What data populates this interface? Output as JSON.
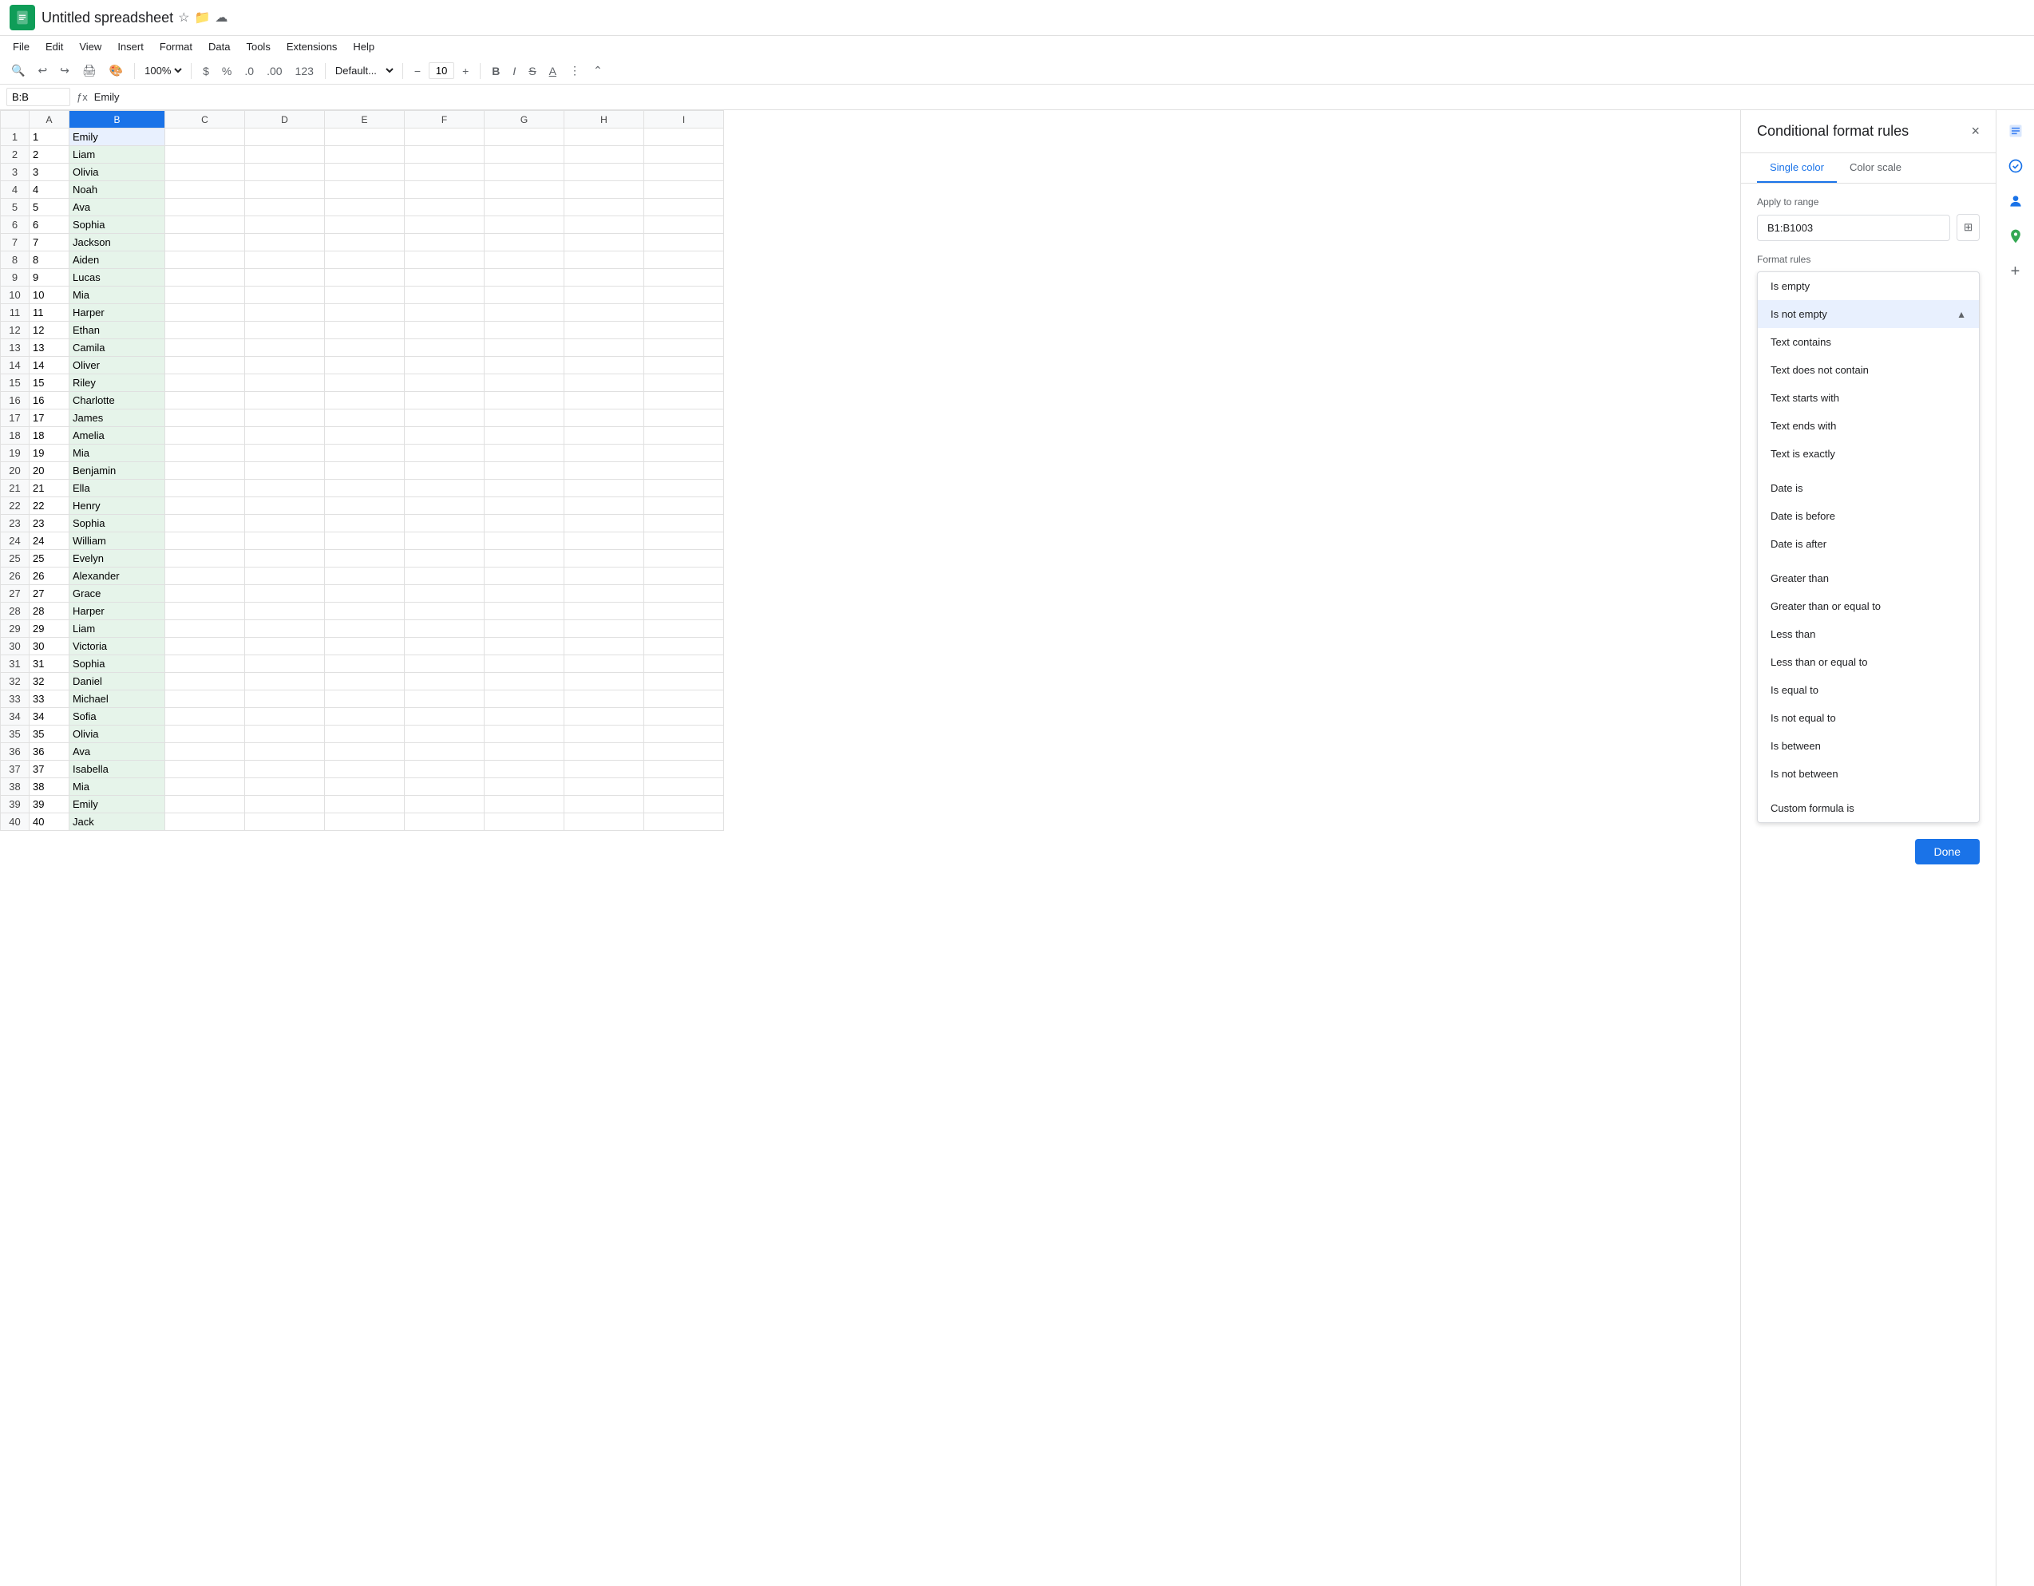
{
  "app": {
    "title": "Untitled spreadsheet",
    "icon_color": "#0f9d58"
  },
  "menu": {
    "items": [
      "File",
      "Edit",
      "View",
      "Insert",
      "Format",
      "Data",
      "Tools",
      "Extensions",
      "Help"
    ]
  },
  "toolbar": {
    "zoom": "100%",
    "font": "Default...",
    "font_size": "10",
    "bold": "B",
    "italic": "I",
    "strikethrough": "S"
  },
  "formula_bar": {
    "cell_ref": "B:B",
    "formula_text": "Emily"
  },
  "columns": [
    "",
    "A",
    "B",
    "C",
    "D",
    "E",
    "F",
    "G",
    "H",
    "I"
  ],
  "rows": [
    {
      "num": 1,
      "a": "1",
      "b": "Emily"
    },
    {
      "num": 2,
      "a": "2",
      "b": "Liam"
    },
    {
      "num": 3,
      "a": "3",
      "b": "Olivia"
    },
    {
      "num": 4,
      "a": "4",
      "b": "Noah"
    },
    {
      "num": 5,
      "a": "5",
      "b": "Ava"
    },
    {
      "num": 6,
      "a": "6",
      "b": "Sophia"
    },
    {
      "num": 7,
      "a": "7",
      "b": "Jackson"
    },
    {
      "num": 8,
      "a": "8",
      "b": "Aiden"
    },
    {
      "num": 9,
      "a": "9",
      "b": "Lucas"
    },
    {
      "num": 10,
      "a": "10",
      "b": "Mia"
    },
    {
      "num": 11,
      "a": "11",
      "b": "Harper"
    },
    {
      "num": 12,
      "a": "12",
      "b": "Ethan"
    },
    {
      "num": 13,
      "a": "13",
      "b": "Camila"
    },
    {
      "num": 14,
      "a": "14",
      "b": "Oliver"
    },
    {
      "num": 15,
      "a": "15",
      "b": "Riley"
    },
    {
      "num": 16,
      "a": "16",
      "b": "Charlotte"
    },
    {
      "num": 17,
      "a": "17",
      "b": "James"
    },
    {
      "num": 18,
      "a": "18",
      "b": "Amelia"
    },
    {
      "num": 19,
      "a": "19",
      "b": "Mia"
    },
    {
      "num": 20,
      "a": "20",
      "b": "Benjamin"
    },
    {
      "num": 21,
      "a": "21",
      "b": "Ella"
    },
    {
      "num": 22,
      "a": "22",
      "b": "Henry"
    },
    {
      "num": 23,
      "a": "23",
      "b": "Sophia"
    },
    {
      "num": 24,
      "a": "24",
      "b": "William"
    },
    {
      "num": 25,
      "a": "25",
      "b": "Evelyn"
    },
    {
      "num": 26,
      "a": "26",
      "b": "Alexander"
    },
    {
      "num": 27,
      "a": "27",
      "b": "Grace"
    },
    {
      "num": 28,
      "a": "28",
      "b": "Harper"
    },
    {
      "num": 29,
      "a": "29",
      "b": "Liam"
    },
    {
      "num": 30,
      "a": "30",
      "b": "Victoria"
    },
    {
      "num": 31,
      "a": "31",
      "b": "Sophia"
    },
    {
      "num": 32,
      "a": "32",
      "b": "Daniel"
    },
    {
      "num": 33,
      "a": "33",
      "b": "Michael"
    },
    {
      "num": 34,
      "a": "34",
      "b": "Sofia"
    },
    {
      "num": 35,
      "a": "35",
      "b": "Olivia"
    },
    {
      "num": 36,
      "a": "36",
      "b": "Ava"
    },
    {
      "num": 37,
      "a": "37",
      "b": "Isabella"
    },
    {
      "num": 38,
      "a": "38",
      "b": "Mia"
    },
    {
      "num": 39,
      "a": "39",
      "b": "Emily"
    },
    {
      "num": 40,
      "a": "40",
      "b": "Jack"
    }
  ],
  "panel": {
    "title": "Conditional format rules",
    "close_label": "×",
    "tab_single": "Single color",
    "tab_scale": "Color scale",
    "apply_label": "Apply to range",
    "range_value": "B1:B1003",
    "format_rules_label": "Format rules",
    "dropdown_items": [
      {
        "label": "Is empty",
        "selected": false
      },
      {
        "label": "Is not empty",
        "selected": true
      },
      {
        "label": "Text contains",
        "selected": false
      },
      {
        "label": "Text does not contain",
        "selected": false
      },
      {
        "label": "Text starts with",
        "selected": false
      },
      {
        "label": "Text ends with",
        "selected": false
      },
      {
        "label": "Text is exactly",
        "selected": false
      },
      {
        "spacer": true
      },
      {
        "label": "Date is",
        "selected": false
      },
      {
        "label": "Date is before",
        "selected": false
      },
      {
        "label": "Date is after",
        "selected": false
      },
      {
        "spacer": true
      },
      {
        "label": "Greater than",
        "selected": false
      },
      {
        "label": "Greater than or equal to",
        "selected": false
      },
      {
        "label": "Less than",
        "selected": false
      },
      {
        "label": "Less than or equal to",
        "selected": false
      },
      {
        "label": "Is equal to",
        "selected": false
      },
      {
        "label": "Is not equal to",
        "selected": false
      },
      {
        "label": "Is between",
        "selected": false
      },
      {
        "label": "Is not between",
        "selected": false
      },
      {
        "spacer": true
      },
      {
        "label": "Custom formula is",
        "selected": false
      }
    ],
    "done_label": "Done"
  },
  "side_icons": [
    "sheets-icon",
    "tasks-icon",
    "people-icon",
    "maps-icon",
    "add-icon"
  ]
}
